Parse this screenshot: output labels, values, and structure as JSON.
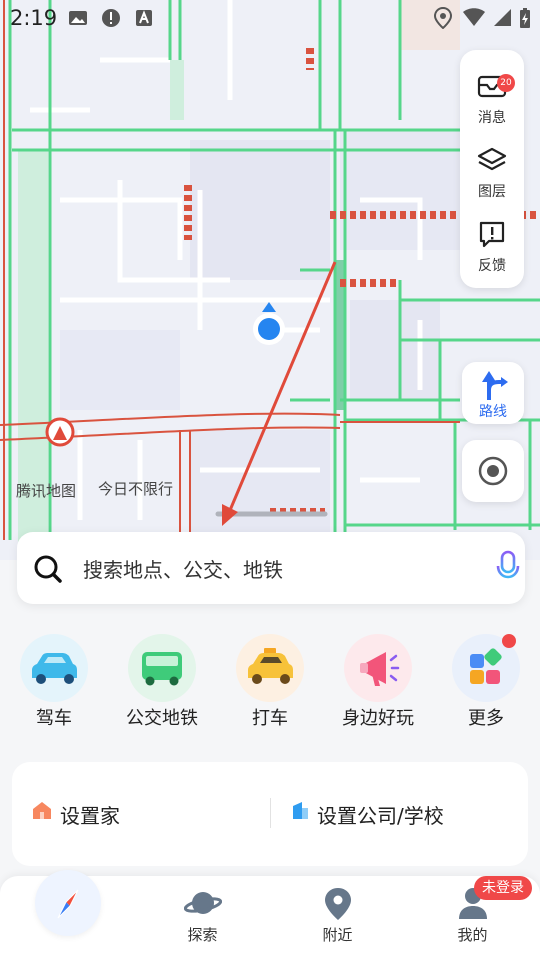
{
  "status_bar": {
    "time": "2:19"
  },
  "map": {
    "attribution": "腾讯地图",
    "restriction_text": "今日不限行"
  },
  "right_panel": {
    "messages_label": "消息",
    "messages_badge": "20",
    "layers_label": "图层",
    "feedback_label": "反馈"
  },
  "route_button": {
    "label": "路线"
  },
  "search": {
    "placeholder": "搜索地点、公交、地铁"
  },
  "quick_entries": [
    {
      "label": "驾车",
      "icon": "car-icon",
      "bg": "#e4f4fb"
    },
    {
      "label": "公交地铁",
      "icon": "bus-icon",
      "bg": "#e3f5ea"
    },
    {
      "label": "打车",
      "icon": "taxi-icon",
      "bg": "#fdf0e2"
    },
    {
      "label": "身边好玩",
      "icon": "megaphone-icon",
      "bg": "#fde9ec"
    },
    {
      "label": "更多",
      "icon": "more-apps-icon",
      "bg": "#e9f0fb"
    }
  ],
  "places": {
    "home_label": "设置家",
    "work_label": "设置公司/学校"
  },
  "bottom_nav": {
    "explore_label": "探索",
    "nearby_label": "附近",
    "mine_label": "我的",
    "login_badge": "未登录"
  },
  "colors": {
    "accent": "#2d6cf0",
    "badge": "#f04848",
    "road_green": "#56d68a",
    "road_red": "#d9533f"
  }
}
